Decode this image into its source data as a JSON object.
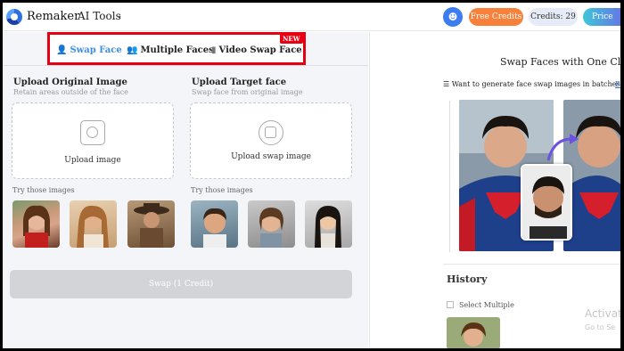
{
  "header": {
    "brand": "Remaker",
    "ai_tools": "AI Tools",
    "free_credits": "Free Credits",
    "credits": "Credits: 29",
    "price": "Price"
  },
  "tabs": {
    "swap_face": "Swap Face",
    "multiple_faces": "Multiple Faces",
    "video_swap_face": "Video Swap Face",
    "new_badge": "NEW"
  },
  "original": {
    "title": "Upload Original Image",
    "subtitle": "Retain areas outside of the face",
    "upload_label": "Upload image",
    "try_label": "Try those images"
  },
  "target": {
    "title": "Upload Target face",
    "subtitle": "Swap face from original image",
    "upload_label": "Upload swap image",
    "try_label": "Try those images"
  },
  "swap_button": "Swap (1 Credit)",
  "right": {
    "title": "Swap Faces with One Click",
    "batch_text": "Want to generate face swap images in batches?",
    "batch_link": "B",
    "history": "History",
    "select_multiple": "Select Multiple",
    "watermark_line1": "Activat",
    "watermark_line2": "Go to Se"
  },
  "colors": {
    "accent_blue": "#3c8de6",
    "highlight_red": "#e60012",
    "free_credits_orange": "#f7813a"
  }
}
